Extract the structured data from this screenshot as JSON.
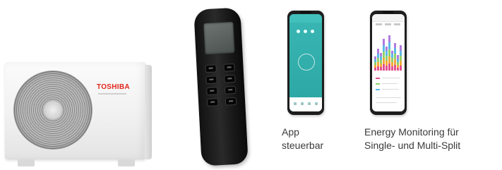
{
  "outdoor_unit": {
    "brand": "TOSHIBA",
    "brand_color": "#e0261c"
  },
  "remote_control": {
    "icon": "remote-control-icon"
  },
  "app_feature": {
    "line1": "App",
    "line2": "steuerbar",
    "accent": "#3ab7b4"
  },
  "energy_feature": {
    "line1": "Energy Monitoring für",
    "line2": "Single- und Multi-Split",
    "chart_colors": [
      "#e4508f",
      "#f2a93b",
      "#8ed16b",
      "#5bb8e6",
      "#b07be0"
    ]
  }
}
